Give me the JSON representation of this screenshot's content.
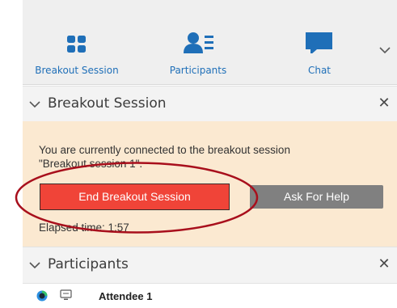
{
  "toolbar": {
    "buttons": [
      {
        "label": "Breakout Session",
        "icon": "breakout-grid-icon"
      },
      {
        "label": "Participants",
        "icon": "participants-icon"
      },
      {
        "label": "Chat",
        "icon": "chat-bubble-icon"
      }
    ],
    "overflow_icon": "chevron-down-icon"
  },
  "breakout_panel": {
    "title": "Breakout Session",
    "close_glyph": "✕",
    "message_line1": "You are currently connected to the breakout session",
    "message_line2": "\"Breakout session 1\".",
    "end_button_label": "End Breakout Session",
    "help_button_label": "Ask For Help",
    "elapsed_text": "Elapsed time: 1:57"
  },
  "participants_panel": {
    "title": "Participants",
    "close_glyph": "✕",
    "attendees": [
      {
        "name": "Attendee 1",
        "status_icon": "presence-status-icon",
        "device_icon": "desktop-device-icon"
      }
    ]
  },
  "colors": {
    "accent_blue": "#1f6fb8",
    "end_button_red": "#f04438",
    "help_button_gray": "#808080",
    "panel_body_tint": "#fbe9d1",
    "annotation_red": "#a80f1c"
  }
}
